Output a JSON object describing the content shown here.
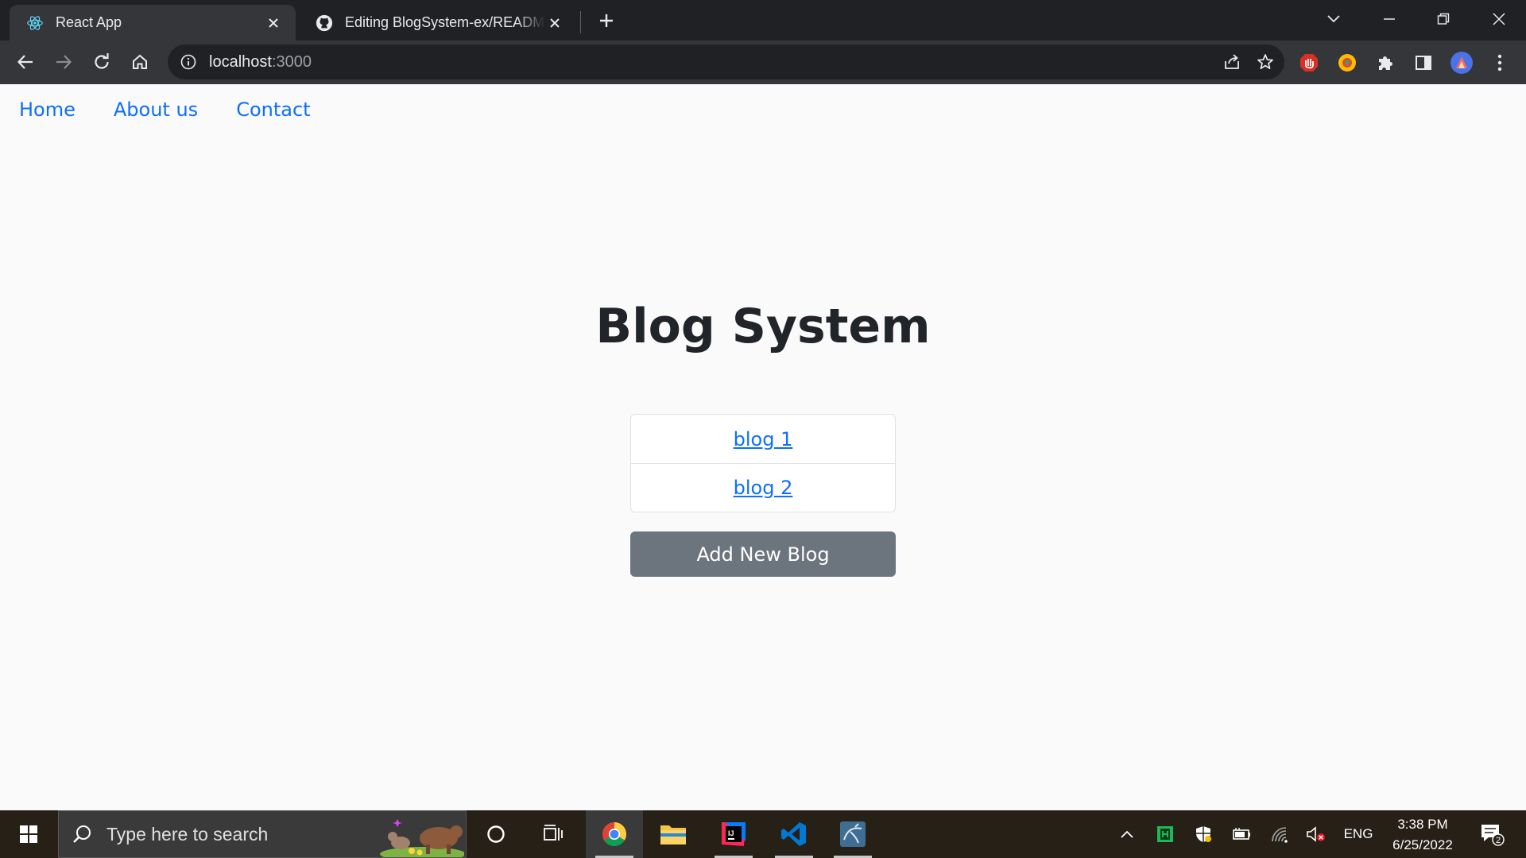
{
  "browser": {
    "tabs": [
      {
        "title": "React App",
        "active": true
      },
      {
        "title": "Editing BlogSystem-ex/README.md",
        "active": false
      }
    ],
    "url_host": "localhost",
    "url_port": ":3000"
  },
  "nav": {
    "links": [
      "Home",
      "About us",
      "Contact"
    ]
  },
  "main": {
    "title": "Blog System",
    "blogs": [
      "blog 1",
      "blog 2"
    ],
    "add_button": "Add New Blog"
  },
  "taskbar": {
    "search_placeholder": "Type here to search",
    "language": "ENG",
    "time": "3:38 PM",
    "date": "6/25/2022",
    "notification_count": "2"
  },
  "colors": {
    "link": "#0d6efd",
    "button": "#6c757d",
    "browser_dark": "#202124",
    "browser_tab": "#35363a"
  }
}
